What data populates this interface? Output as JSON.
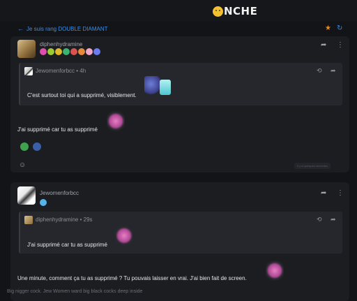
{
  "header": {
    "logo_text": "NCHE",
    "logo_icon": "smiley-face-icon"
  },
  "breadcrumb": {
    "back_icon": "arrow-left-icon",
    "label": "Je suis rang DOUBLE DIAMANT",
    "star_icon": "star-icon",
    "refresh_icon": "refresh-icon"
  },
  "posts": [
    {
      "author": "diphenhydramine",
      "badges": [
        "#e04fb0",
        "#9acd32",
        "#e0b82a",
        "#3cb371",
        "#d9534f",
        "#e48a3a",
        "#f4a6c8",
        "#6a7cf0"
      ],
      "quote": {
        "author": "Jewomenforbcc",
        "time": "4h",
        "text": "C'est surtout toi qui a supprimé, visiblement."
      },
      "text": "J'ai supprimé car tu as supprimé",
      "reactions": [
        "green-frog-reaction",
        "blue-hat-reaction"
      ],
      "seen": "Il y a quelques secondes"
    },
    {
      "author": "Jewomenforbcc",
      "quote": {
        "author": "diphenhydramine",
        "time": "29s",
        "text": "J'ai supprimé car tu as supprimé"
      },
      "text": "Une minute, comment ça tu as supprimé ? Tu pouvais laisser en vrai. J'ai bien fait de screen.",
      "signature": "Big nigger cock. Jew Women ward big black cocks deep inside"
    }
  ],
  "colors": {
    "accent": "#3c8ee8",
    "star": "#f08a1c",
    "card": "#1c1d21",
    "quote": "#26272c"
  }
}
